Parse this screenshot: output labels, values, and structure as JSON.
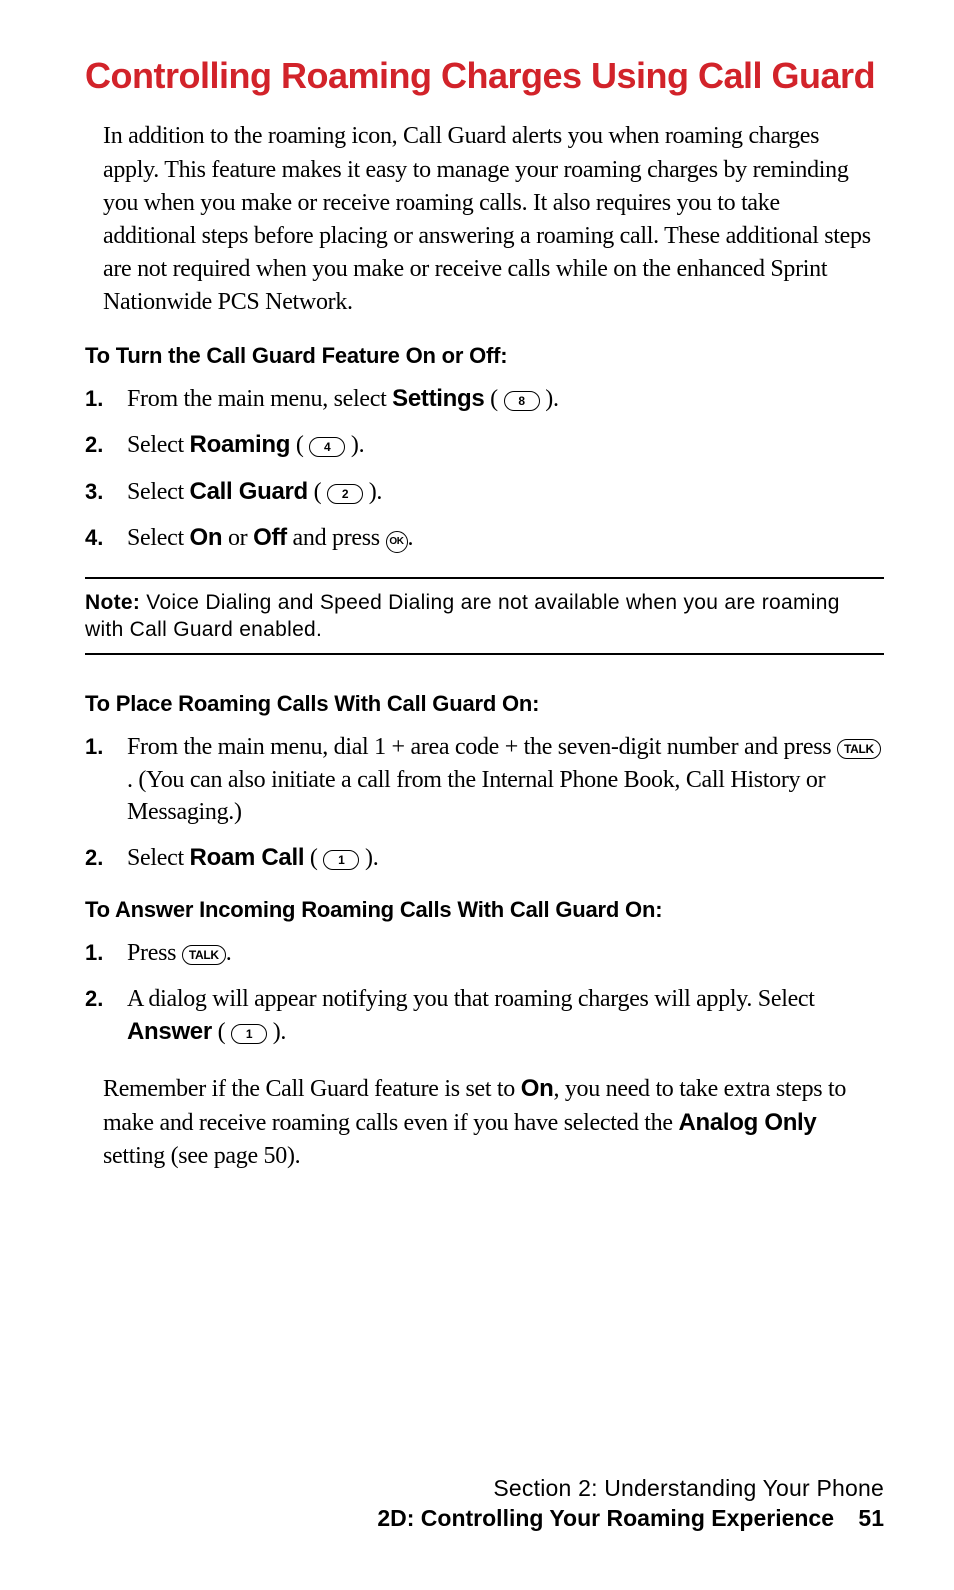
{
  "title": "Controlling Roaming Charges Using Call Guard",
  "intro": "In addition to the roaming icon, Call Guard alerts you when roaming charges apply. This feature makes it easy to manage your roaming charges by reminding you when you make or receive roaming calls. It also requires you to take additional steps before placing or answering a roaming call. These additional steps are not required when you make or receive calls while on the enhanced Sprint Nationwide PCS Network.",
  "section1": {
    "heading": "To Turn the Call Guard Feature On or Off:",
    "steps": [
      {
        "num": "1.",
        "pre": "From the main menu, select ",
        "bold": "Settings",
        "open": " ( ",
        "key": "8",
        "close": " )."
      },
      {
        "num": "2.",
        "pre": "Select ",
        "bold": "Roaming",
        "open": " ( ",
        "key": "4",
        "close": " )."
      },
      {
        "num": "3.",
        "pre": "Select ",
        "bold": "Call Guard",
        "open": " ( ",
        "key": "2",
        "close": " )."
      },
      {
        "num": "4.",
        "pre": "Select ",
        "bold": "On",
        "mid": " or ",
        "bold2": "Off",
        "post": " and press ",
        "key_round": "OK",
        "tail": "."
      }
    ]
  },
  "note": {
    "label": "Note:",
    "text": " Voice Dialing and Speed Dialing are not available when you are roaming with Call Guard enabled."
  },
  "section2": {
    "heading": "To Place Roaming Calls With Call Guard On:",
    "steps": [
      {
        "num": "1.",
        "line1": "From the main menu, dial 1 + area code + the seven-digit number and press ",
        "key": "TALK",
        "line2": ". (You can also initiate a call from the Internal Phone Book, Call History or Messaging.)"
      },
      {
        "num": "2.",
        "pre": "Select ",
        "bold": "Roam Call",
        "open": " ( ",
        "key2": "1",
        "close": " )."
      }
    ]
  },
  "section3": {
    "heading": "To Answer Incoming Roaming Calls With Call Guard On:",
    "steps": [
      {
        "num": "1.",
        "pre": "Press ",
        "key": "TALK",
        "tail": "."
      },
      {
        "num": "2.",
        "line1": "A dialog will appear notifying you that roaming charges will apply. Select ",
        "bold": "Answer",
        "open": " ( ",
        "key2": "1",
        "close": " )."
      }
    ]
  },
  "outro": {
    "p1": "Remember if the Call Guard feature is set to ",
    "b1": "On",
    "p2": ", you need to take extra steps to make and receive roaming calls even if you have selected the ",
    "b2": "Analog Only",
    "p3": " setting (see page 50)."
  },
  "footer": {
    "line1": "Section 2: Understanding Your Phone",
    "line2": "2D: Controlling Your Roaming Experience",
    "page": "51"
  }
}
